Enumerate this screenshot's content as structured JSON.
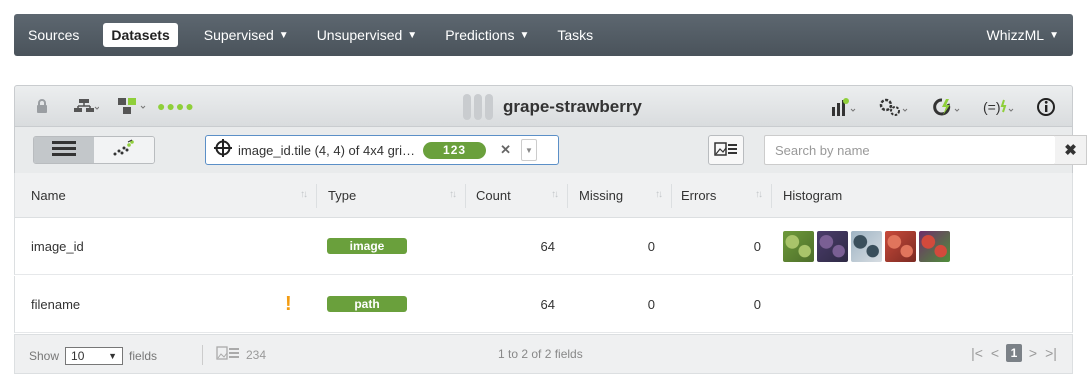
{
  "nav": {
    "sources": "Sources",
    "datasets": "Datasets",
    "supervised": "Supervised",
    "unsupervised": "Unsupervised",
    "predictions": "Predictions",
    "tasks": "Tasks",
    "whizzml": "WhizzML"
  },
  "dataset": {
    "name": "grape-strawberry"
  },
  "filter": {
    "text": "image_id.tile (4, 4) of 4x4 gri…",
    "badge": "123"
  },
  "search": {
    "placeholder": "Search by name"
  },
  "columns": {
    "name": "Name",
    "type": "Type",
    "count": "Count",
    "missing": "Missing",
    "errors": "Errors",
    "histogram": "Histogram"
  },
  "rows": [
    {
      "name": "image_id",
      "type": "image",
      "count": "64",
      "missing": "0",
      "errors": "0"
    },
    {
      "name": "filename",
      "type": "path",
      "count": "64",
      "missing": "0",
      "errors": "0"
    }
  ],
  "thumbnails": [
    {
      "name": "thumbnail-grapes-green",
      "colors": [
        "#6e9a3a",
        "#a9c46a",
        "#4d6e2a"
      ]
    },
    {
      "name": "thumbnail-grapes-purple",
      "colors": [
        "#4b3c6b",
        "#7a5f94",
        "#2e2a44"
      ]
    },
    {
      "name": "thumbnail-camera",
      "colors": [
        "#9fb4c4",
        "#3a4f5c",
        "#d7dde2"
      ]
    },
    {
      "name": "thumbnail-strawberries",
      "colors": [
        "#c84a3a",
        "#e1755c",
        "#7b2a22"
      ]
    },
    {
      "name": "thumbnail-fruit-mix",
      "colors": [
        "#6f2f6a",
        "#d24a3c",
        "#4e8f3a"
      ]
    }
  ],
  "footer": {
    "show": "Show",
    "page_size": "10",
    "fields": "fields",
    "image_count": "234",
    "range": "1 to 2 of 2 fields",
    "current_page": "1"
  },
  "colors": {
    "accent_green": "#6aa03c",
    "nav_bg": "#4f5861",
    "lime_dots": "#8fcf3a"
  }
}
